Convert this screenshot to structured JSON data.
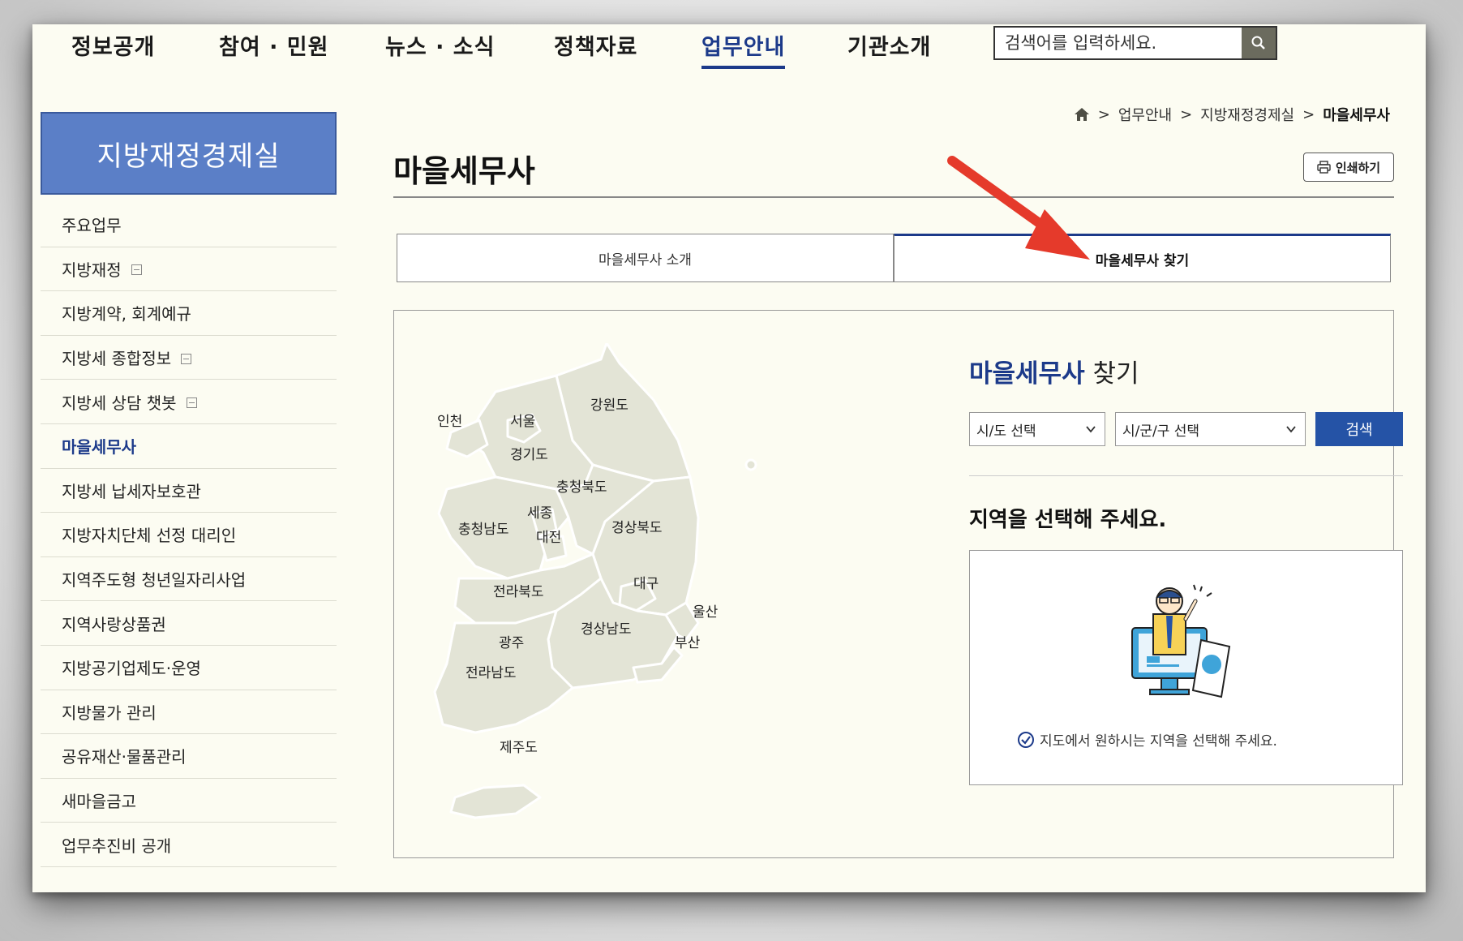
{
  "gnb": {
    "items": [
      "정보공개",
      "참여 · 민원",
      "뉴스 · 소식",
      "정책자료",
      "업무안내",
      "기관소개"
    ],
    "active_index": 4
  },
  "search": {
    "placeholder": "검색어를 입력하세요.",
    "button_icon": "search-icon"
  },
  "sidebar": {
    "title": "지방재정경제실",
    "items": [
      {
        "label": "주요업무",
        "has_sub": false
      },
      {
        "label": "지방재정",
        "has_sub": true
      },
      {
        "label": "지방계약, 회계예규",
        "has_sub": false
      },
      {
        "label": "지방세 종합정보",
        "has_sub": true
      },
      {
        "label": "지방세 상담 챗봇",
        "has_sub": true
      },
      {
        "label": "마을세무사",
        "has_sub": false,
        "active": true
      },
      {
        "label": "지방세 납세자보호관",
        "has_sub": false
      },
      {
        "label": "지방자치단체 선정 대리인",
        "has_sub": false
      },
      {
        "label": "지역주도형 청년일자리사업",
        "has_sub": false
      },
      {
        "label": "지역사랑상품권",
        "has_sub": false
      },
      {
        "label": "지방공기업제도·운영",
        "has_sub": false
      },
      {
        "label": "지방물가 관리",
        "has_sub": false
      },
      {
        "label": "공유재산·물품관리",
        "has_sub": false
      },
      {
        "label": "새마을금고",
        "has_sub": false
      },
      {
        "label": "업무추진비 공개",
        "has_sub": false
      }
    ]
  },
  "breadcrumb": {
    "home_icon": "home-icon",
    "items": [
      "업무안내",
      "지방재정경제실",
      "마을세무사"
    ]
  },
  "page": {
    "title": "마을세무사",
    "print_label": "인쇄하기"
  },
  "tabs": [
    {
      "label": "마을세무사 소개",
      "active": false
    },
    {
      "label": "마을세무사 찾기",
      "active": true
    }
  ],
  "map": {
    "regions": [
      "인천",
      "서울",
      "강원도",
      "경기도",
      "충청북도",
      "세종",
      "충청남도",
      "대전",
      "경상북도",
      "대구",
      "전라북도",
      "울산",
      "경상남도",
      "광주",
      "부산",
      "전라남도",
      "제주도"
    ]
  },
  "finder": {
    "title_accent": "마을세무사",
    "title_rest": " 찾기",
    "sido_select": "시/도 선택",
    "sigungu_select": "시/군/구 선택",
    "search_button": "검색",
    "prompt": "지역을 선택해 주세요.",
    "guide_text": "지도에서 원하시는 지역을 선택해 주세요."
  },
  "colors": {
    "accent": "#1c3a8a",
    "sidebar_title_bg": "#5b7fc7",
    "search_button_bg": "#2553a6",
    "annotation_arrow": "#e53a2b",
    "map_fill": "#e3e4d6"
  }
}
